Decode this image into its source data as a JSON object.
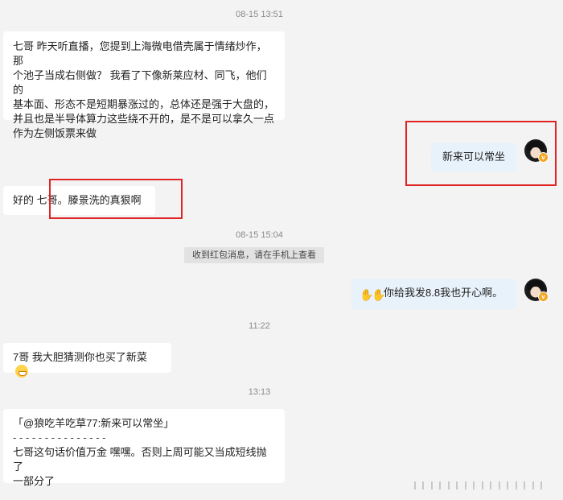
{
  "timestamps": {
    "t1": "08-15 13:51",
    "t2": "08-15 15:04",
    "t3": "11:22",
    "t4": "13:13"
  },
  "messages": {
    "m1": {
      "lines": [
        "七哥  昨天听直播，您提到上海微电借壳属于情绪炒作，那",
        "个池子当成右侧做？ 我看了下像新莱应材、同飞，他们的",
        "基本面、形态不是短期暴涨过的，总体还是强于大盘的，",
        "并且也是半导体算力这些绕不开的，是不是可以拿久一点",
        "作为左侧饭票来做"
      ]
    },
    "m2": {
      "text": "新来可以常坐"
    },
    "m3": {
      "text": "好的 七哥。滕景洗的真狠啊"
    },
    "system": {
      "text": "收到红包消息，请在手机上查看"
    },
    "m4": {
      "text": "你给我发8.8我也开心啊。"
    },
    "m5": {
      "text": "7哥 我大胆猜测你也买了新菜"
    },
    "m6": {
      "quote": "「@狼吃羊吃草77:新来可以常坐」",
      "divider": "- - - - - - - - - - - - - - -",
      "lines": [
        "七哥这句话价值万金 嘿嘿。否则上周可能又当成短线抛了",
        "一部分了"
      ]
    }
  },
  "avatar_badge": "v",
  "icons": {
    "hand_emoji": "waving-hands-icon",
    "grin_emoji": "grinning-face-icon"
  },
  "colors": {
    "highlight": "#e02424",
    "my_bubble": "#e8f2fb",
    "other_bubble": "#ffffff",
    "background": "#f3f3f3"
  }
}
